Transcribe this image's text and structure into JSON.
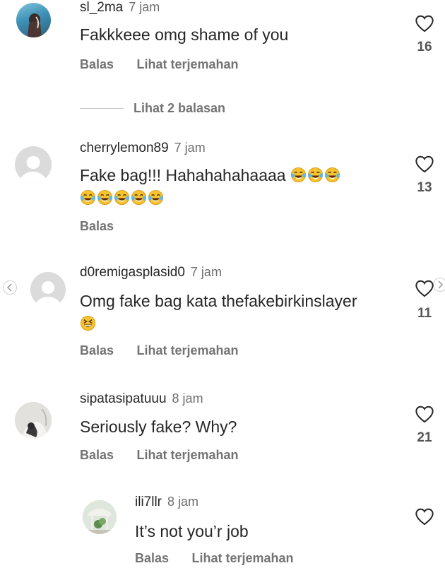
{
  "comments": [
    {
      "username": "sl_2ma",
      "time": "7 jam",
      "text": "Fakkkeee omg shame of you",
      "likes": "16",
      "reply": "Balas",
      "translate": "Lihat terjemahan",
      "view_replies": "Lihat 2 balasan"
    },
    {
      "username": "cherrylemon89",
      "time": "7 jam",
      "text": "Fake bag!!! Hahahahahaaaa",
      "likes": "13",
      "reply": "Balas",
      "emoji_name": "face-with-tears-of-joy"
    },
    {
      "username": "d0remigasplasid0",
      "time": "7 jam",
      "text": "Omg fake bag kata thefakebirkinslayer",
      "likes": "11",
      "reply": "Balas",
      "translate": "Lihat terjemahan",
      "emoji_name": "grinning-squinting-face"
    },
    {
      "username": "sipatasipatuuu",
      "time": "8 jam",
      "text": "Seriously fake? Why?",
      "likes": "21",
      "reply": "Balas",
      "translate": "Lihat terjemahan"
    },
    {
      "username": "ili7llr",
      "time": "8 jam",
      "text": "It’s not you’r job",
      "reply": "Balas",
      "translate": "Lihat terjemahan"
    }
  ],
  "colors": {
    "text": "#262626",
    "secondary": "#737373",
    "emoji": "#f7c331"
  }
}
